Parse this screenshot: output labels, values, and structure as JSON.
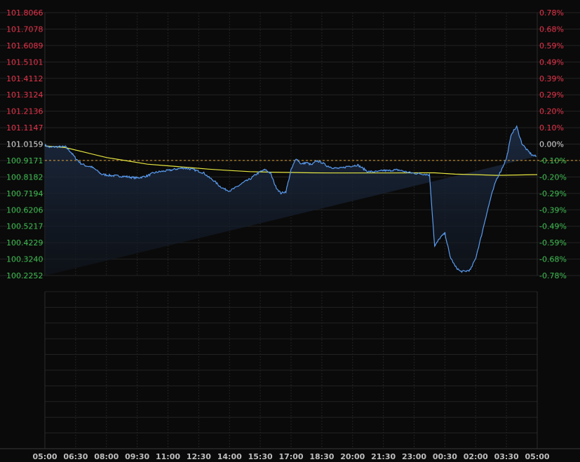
{
  "chart_data": {
    "type": "line",
    "title": "",
    "xlabel": "",
    "ylabel": "",
    "x_ticks": [
      "05:00",
      "06:30",
      "08:00",
      "09:30",
      "11:00",
      "12:30",
      "14:00",
      "15:30",
      "17:00",
      "18:30",
      "20:00",
      "21:30",
      "23:00",
      "00:30",
      "02:00",
      "03:30",
      "05:00"
    ],
    "y_ticks_left": [
      "101.8066",
      "101.7078",
      "101.6089",
      "101.5101",
      "101.4112",
      "101.3124",
      "101.2136",
      "101.1147",
      "101.0159",
      "100.9171",
      "100.8182",
      "100.7194",
      "100.6206",
      "100.5217",
      "100.4229",
      "100.3240",
      "100.2252"
    ],
    "y_ticks_right": [
      "0.78%",
      "0.68%",
      "0.59%",
      "0.49%",
      "0.39%",
      "0.29%",
      "0.20%",
      "0.10%",
      "0.00%",
      "-0.10%",
      "-0.20%",
      "-0.29%",
      "-0.39%",
      "-0.49%",
      "-0.59%",
      "-0.68%",
      "-0.78%"
    ],
    "ylim": [
      100.2252,
      101.8066
    ],
    "reference_value": 100.9171,
    "base_value": 101.0159,
    "grid": true,
    "colors": {
      "price_line": "#5a9cf0",
      "average_line": "#e6e640",
      "up_text": "#e8334a",
      "down_text": "#3fbf52",
      "reference_line": "#e0a030",
      "grid": "#232323",
      "background": "#0a0a0a"
    },
    "series": [
      {
        "name": "",
        "role": "price",
        "x_hours": [
          0,
          0.25,
          0.5,
          0.75,
          1,
          1.25,
          1.5,
          1.75,
          2,
          2.25,
          2.5,
          2.75,
          3,
          3.25,
          3.5,
          3.75,
          4,
          4.25,
          4.5,
          4.75,
          5,
          5.25,
          5.5,
          5.75,
          6,
          6.25,
          6.5,
          6.75,
          7,
          7.25,
          7.5,
          7.75,
          8,
          8.25,
          8.5,
          8.75,
          9,
          9.25,
          9.5,
          9.75,
          10,
          10.25,
          10.5,
          10.75,
          11,
          11.25,
          11.5,
          11.75,
          12,
          12.25,
          12.5,
          12.75,
          13,
          13.25,
          13.5,
          13.75,
          14,
          14.25,
          14.5,
          14.75,
          15,
          15.25,
          15.5,
          15.75,
          16,
          16.25,
          16.5,
          16.75,
          17,
          17.25,
          17.5,
          17.75,
          18,
          18.25,
          18.5,
          18.75,
          19,
          19.25,
          19.5,
          19.75,
          20,
          20.25,
          20.5,
          20.75,
          21,
          21.25,
          21.5,
          21.75,
          22,
          22.25,
          22.5,
          22.75,
          23,
          23.25,
          23.5,
          23.75,
          24
        ],
        "values": [
          101.01,
          100.995,
          101.0,
          101.0,
          101.0,
          100.97,
          100.93,
          100.9,
          100.885,
          100.88,
          100.86,
          100.835,
          100.83,
          100.826,
          100.825,
          100.822,
          100.82,
          100.815,
          100.812,
          100.818,
          100.825,
          100.84,
          100.848,
          100.852,
          100.857,
          100.862,
          100.868,
          100.872,
          100.868,
          100.862,
          100.852,
          100.842,
          100.815,
          100.795,
          100.765,
          100.745,
          100.735,
          100.75,
          100.77,
          100.79,
          100.805,
          100.83,
          100.85,
          100.862,
          100.84,
          100.76,
          100.72,
          100.73,
          100.86,
          100.93,
          100.895,
          100.905,
          100.89,
          100.915,
          100.905,
          100.885,
          100.875,
          100.87,
          100.872,
          100.882,
          100.885,
          100.89,
          100.87,
          100.85,
          100.85,
          100.85,
          100.858,
          100.855,
          100.86,
          100.86,
          100.852,
          100.845,
          100.84,
          100.838,
          100.835,
          100.83,
          100.4,
          100.45,
          100.48,
          100.34,
          100.28,
          100.25,
          100.25,
          100.26,
          100.33,
          100.45,
          100.58,
          100.7,
          100.8,
          100.86,
          100.93,
          101.08,
          101.12,
          101.02,
          100.98,
          100.95,
          100.94,
          100.935,
          100.93
        ],
        "extrema": {
          "low": 100.2252,
          "high": 101.13
        }
      },
      {
        "name": "",
        "role": "average",
        "x_hours": [
          0,
          1,
          2,
          3,
          4,
          5,
          6,
          7,
          8,
          9,
          10,
          11,
          12,
          13,
          14,
          15,
          16,
          17,
          18,
          19,
          20,
          21,
          22,
          23,
          24
        ],
        "values": [
          101.005,
          100.995,
          100.965,
          100.935,
          100.915,
          100.895,
          100.885,
          100.875,
          100.865,
          100.857,
          100.85,
          100.847,
          100.845,
          100.843,
          100.842,
          100.842,
          100.842,
          100.842,
          100.843,
          100.843,
          100.835,
          100.832,
          100.828,
          100.83,
          100.832
        ]
      }
    ]
  }
}
